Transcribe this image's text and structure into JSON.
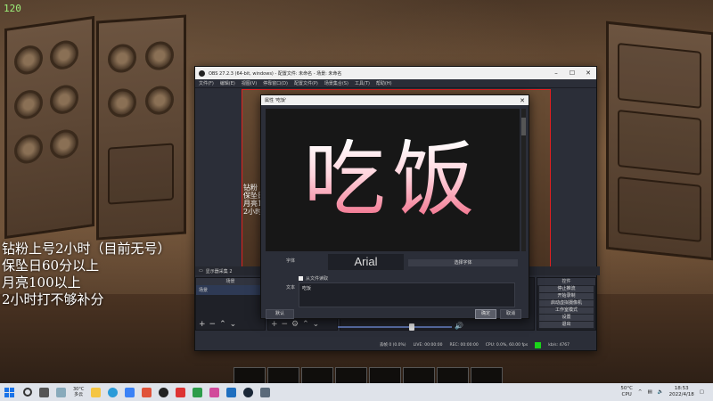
{
  "hud": {
    "fps": "120"
  },
  "stream_overlay": {
    "lines": [
      "钻粉上号2小时（目前无号）",
      "保坠日60分以上",
      "月亮100以上",
      "2小时打不够补分"
    ]
  },
  "obs": {
    "title": "OBS 27.2.3 (64-bit, windows) - 配置文件: 未命名 - 场景: 未命名",
    "menu": [
      "文件(F)",
      "编辑(E)",
      "视图(V)",
      "停靠窗口(D)",
      "配置文件(P)",
      "场景集合(S)",
      "工具(T)",
      "帮助(H)"
    ],
    "preview_overlay": [
      "钻粉",
      "保坠日",
      "月亮10",
      "2小时"
    ],
    "source_row_label": "显示器采集 2",
    "docks": {
      "scenes_header": "场景",
      "scene_item": "场景",
      "sources_header": "来源",
      "controls_header": "控件",
      "controls": [
        "停止推流",
        "开始录制",
        "启动虚拟摄像机",
        "工作室模式",
        "设置",
        "退出"
      ]
    },
    "status": {
      "dropped": "丢帧 0 (0.0%)",
      "live": "LIVE: 00:00:00",
      "rec": "REC: 00:00:00",
      "cpu": "CPU: 0.0%, 60.00 fps",
      "bitrate": "kb/s: 4767"
    }
  },
  "dialog": {
    "title": "属性 '吃饭'",
    "preview_text": "吃饭",
    "font_label": "字体",
    "font_name": "Arial",
    "select_font_button": "选择字体",
    "from_file_checkbox": "从文件读取",
    "text_label": "文本",
    "text_value": "吃饭",
    "defaults_button": "默认",
    "ok_button": "确定",
    "cancel_button": "取消"
  },
  "taskbar": {
    "weather_temp": "30°C",
    "weather_desc": "多云",
    "cpu_temp": "50°C",
    "cpu_label": "CPU",
    "time": "18:53",
    "date": "2022/4/18"
  },
  "colors": {
    "preview_border": "#e02020",
    "accent_pink": "#f06c88",
    "live_indicator": "#19d519",
    "windows_blue": "#1a73e8"
  }
}
